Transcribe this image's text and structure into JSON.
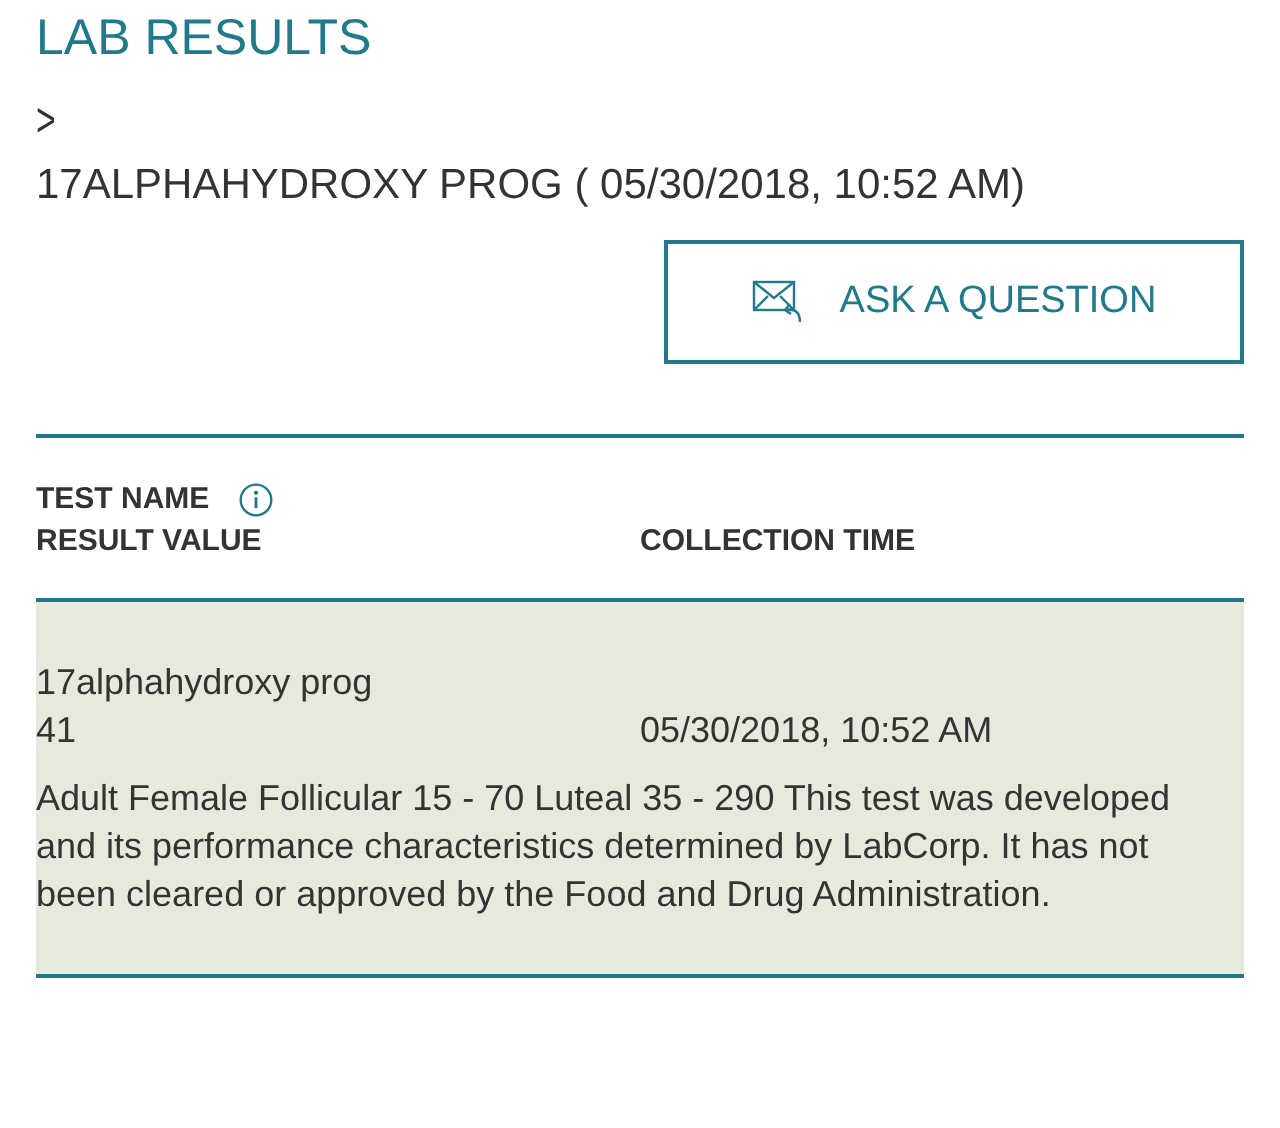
{
  "page_title": "LAB RESULTS",
  "breadcrumb_separator": ">",
  "heading": "17ALPHAHYDROXY PROG ( 05/30/2018, 10:52 AM)",
  "ask_button": {
    "label": "ASK A QUESTION"
  },
  "table": {
    "columns": [
      {
        "label": "TEST NAME",
        "info": true
      },
      {
        "label": "RESULT VALUE"
      },
      {
        "label": "COLLECTION TIME"
      }
    ],
    "rows": [
      {
        "test_name": "17alphahydroxy prog",
        "result_value": "41",
        "collection_time": "05/30/2018, 10:52 AM",
        "note": "Adult Female Follicular 15 - 70 Luteal 35 - 290 This test was developed and its performance characteristics determined by LabCorp. It has not been cleared or approved by the Food and Drug Administration."
      }
    ]
  }
}
